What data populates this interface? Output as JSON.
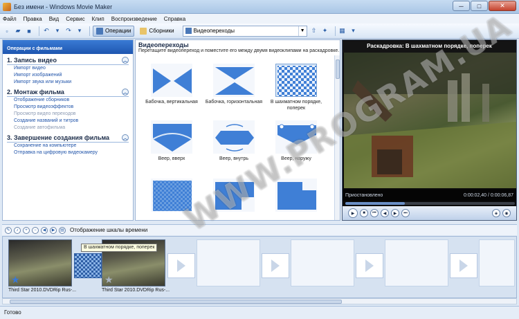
{
  "window": {
    "title": "Без имени - Windows Movie Maker"
  },
  "menu": [
    "Файл",
    "Правка",
    "Вид",
    "Сервис",
    "Клип",
    "Воспроизведение",
    "Справка"
  ],
  "toolbar": {
    "operations_label": "Операции",
    "collections_label": "Сборники",
    "combo_value": "Видеопереходы"
  },
  "left_panel": {
    "header": "Операции с фильмами",
    "sections": [
      {
        "title": "1. Запись видео",
        "links": [
          {
            "label": "Импорт видео",
            "dim": false
          },
          {
            "label": "Импорт изображений",
            "dim": false
          },
          {
            "label": "Импорт звука или музыки",
            "dim": false
          }
        ]
      },
      {
        "title": "2. Монтаж фильма",
        "links": [
          {
            "label": "Отображение сборников",
            "dim": false
          },
          {
            "label": "Просмотр видеоэффектов",
            "dim": false
          },
          {
            "label": "Просмотр видео переходов",
            "dim": true
          },
          {
            "label": "Создание названий и титров",
            "dim": false
          },
          {
            "label": "Создание автофильма",
            "dim": true
          }
        ]
      },
      {
        "title": "3. Завершение создания фильма",
        "links": [
          {
            "label": "Сохранение на компьютере",
            "dim": false
          },
          {
            "label": "Отправка на цифровую видеокамеру",
            "dim": false
          }
        ]
      }
    ]
  },
  "center": {
    "title": "Видеопереходы",
    "description": "Перетащите видеопереход и поместите его между двумя видеоклипами на раскадровке.",
    "transitions": [
      {
        "label": "Бабочка, вертикальная",
        "icon": "butterfly-vertical"
      },
      {
        "label": "Бабочка, горизонтальная",
        "icon": "butterfly-horizontal"
      },
      {
        "label": "В шахматном порядке, поперек",
        "icon": "checkerboard"
      },
      {
        "label": "Веер, вверх",
        "icon": "fan-up"
      },
      {
        "label": "Веер, внутрь",
        "icon": "fan-in"
      },
      {
        "label": "Веер, наружу",
        "icon": "fan-out"
      },
      {
        "label": "",
        "icon": "diagonal-checker"
      },
      {
        "label": "",
        "icon": "steps-left"
      },
      {
        "label": "",
        "icon": "steps-right"
      }
    ]
  },
  "preview": {
    "title": "Раскадровка: В шахматном порядке, поперек",
    "status": "Приостановлено",
    "time": "0:00:02,40 / 0:00:06,87",
    "progress": 0.35
  },
  "timeline": {
    "toggle_label": "Отображение шкалы времени",
    "clips": [
      {
        "name": "Third Star 2010.DVDRip Rus-..."
      },
      {
        "name": "Third Star 2010.DVDRip Rus-..."
      }
    ],
    "tooltip": "В шахматном порядке, поперек"
  },
  "statusbar": {
    "text": "Готово"
  },
  "watermark": "WWW.PROGRAM.UA",
  "colors": {
    "accent": "#3a7bd5",
    "link": "#2255aa",
    "transition_blue": "#3f7fd6"
  }
}
